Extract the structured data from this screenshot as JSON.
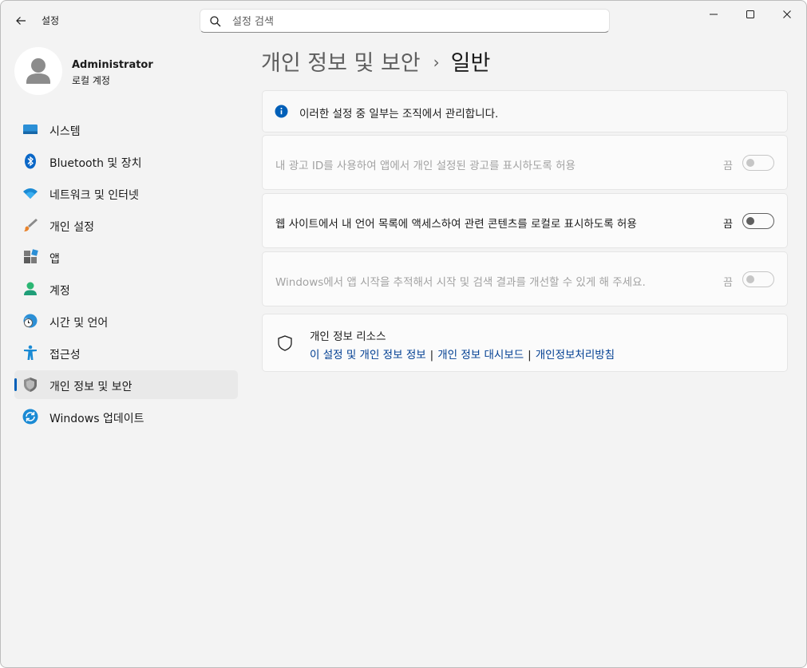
{
  "window": {
    "title": "설정"
  },
  "search": {
    "placeholder": "설정 검색"
  },
  "user": {
    "name": "Administrator",
    "account_type": "로컬 계정"
  },
  "sidebar": {
    "items": [
      {
        "label": "시스템",
        "icon": "system-icon"
      },
      {
        "label": "Bluetooth 및 장치",
        "icon": "bluetooth-icon"
      },
      {
        "label": "네트워크 및 인터넷",
        "icon": "wifi-icon"
      },
      {
        "label": "개인 설정",
        "icon": "brush-icon"
      },
      {
        "label": "앱",
        "icon": "apps-icon"
      },
      {
        "label": "계정",
        "icon": "account-icon"
      },
      {
        "label": "시간 및 언어",
        "icon": "time-language-icon"
      },
      {
        "label": "접근성",
        "icon": "accessibility-icon"
      },
      {
        "label": "개인 정보 및 보안",
        "icon": "shield-icon",
        "active": true
      },
      {
        "label": "Windows 업데이트",
        "icon": "update-icon"
      }
    ]
  },
  "breadcrumb": {
    "parent": "개인 정보 및 보안",
    "separator": "›",
    "current": "일반"
  },
  "info_banner": {
    "text": "이러한 설정 중 일부는 조직에서 관리합니다."
  },
  "settings": [
    {
      "label": "내 광고 ID를 사용하여 앱에서 개인 설정된 광고를 표시하도록 허용",
      "state": "끔",
      "enabled": false
    },
    {
      "label": "웹 사이트에서 내 언어 목록에 액세스하여 관련 콘텐츠를 로컬로 표시하도록 허용",
      "state": "끔",
      "enabled": true
    },
    {
      "label": "Windows에서 앱 시작을 추적해서 시작 및 검색 결과를 개선할 수 있게 해 주세요.",
      "state": "끔",
      "enabled": false
    }
  ],
  "resources": {
    "title": "개인 정보 리소스",
    "links": [
      "이 설정 및 개인 정보 정보",
      "개인 정보 대시보드",
      "개인정보처리방침"
    ],
    "separator": "|"
  },
  "colors": {
    "accent": "#005fb8",
    "link": "#003e92",
    "background": "#f3f3f3"
  }
}
